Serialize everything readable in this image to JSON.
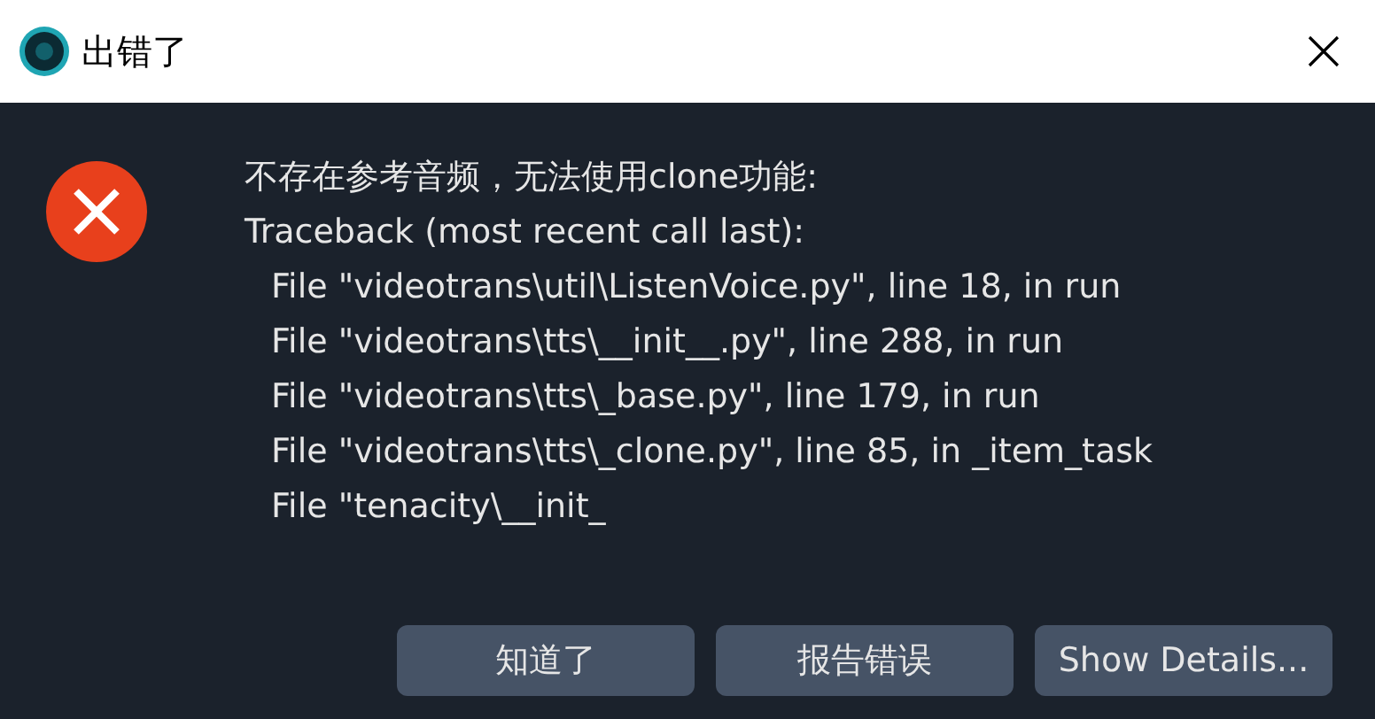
{
  "window": {
    "title": "出错了"
  },
  "message": {
    "lines": [
      {
        "text": "不存在参考音频，无法使用clone功能:",
        "indented": false
      },
      {
        "text": "Traceback (most recent call last):",
        "indented": false
      },
      {
        "text": "File \"videotrans\\util\\ListenVoice.py\", line 18, in run",
        "indented": true
      },
      {
        "text": "File \"videotrans\\tts\\__init__.py\", line 288, in run",
        "indented": true
      },
      {
        "text": "File \"videotrans\\tts\\_base.py\", line 179, in run",
        "indented": true
      },
      {
        "text": "File \"videotrans\\tts\\_clone.py\", line 85, in _item_task",
        "indented": true
      },
      {
        "text": "File \"tenacity\\__init_",
        "indented": true
      }
    ]
  },
  "buttons": [
    {
      "label": "知道了"
    },
    {
      "label": "报告错误"
    },
    {
      "label": "Show Details..."
    }
  ]
}
